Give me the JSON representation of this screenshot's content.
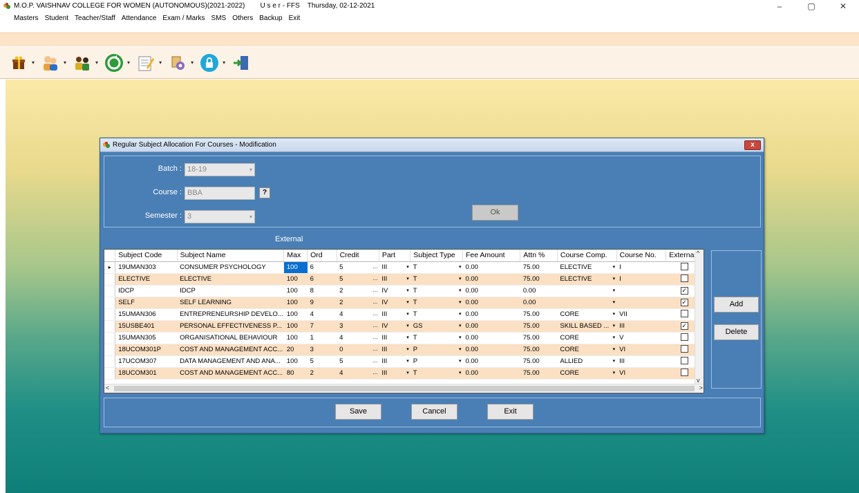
{
  "window": {
    "title": "M.O.P. VAISHNAV COLLEGE FOR WOMEN (AUTONOMOUS)(2021-2022)        U s e r - FFS    Thursday, 02-12-2021",
    "controls": [
      "–",
      "▢",
      "✕"
    ]
  },
  "menu": [
    "Masters",
    "Student",
    "Teacher/Staff",
    "Attendance",
    "Exam / Marks",
    "SMS",
    "Others",
    "Backup",
    "Exit"
  ],
  "toolbar_icons": [
    "gift-icon",
    "users-icon",
    "people-icon",
    "sync-icon",
    "notepad-icon",
    "settings-icon",
    "lock-icon",
    "exit-door-icon"
  ],
  "dialog": {
    "title": "Regular Subject Allocation For Courses - Modification",
    "close": "x",
    "batch_label": "Batch :",
    "batch_value": "18-19",
    "course_label": "Course :",
    "course_value": "BBA",
    "course_help": "?",
    "semester_label": "Semester :",
    "semester_value": "3",
    "ok_label": "Ok",
    "external_label": "External",
    "add_label": "Add",
    "delete_label": "Delete",
    "save_label": "Save",
    "cancel_label": "Cancel",
    "exit_label": "Exit"
  },
  "grid": {
    "columns": [
      "Subject Code",
      "Subject Name",
      "Max",
      "Ord",
      "Credit",
      "Part",
      "Subject Type",
      "Fee Amount",
      "Attn %",
      "Course Comp.",
      "Course No.",
      "Externa"
    ],
    "rows": [
      {
        "code": "19UMAN303",
        "name": "CONSUMER PSYCHOLOGY",
        "max": "100",
        "ord": "6",
        "credit": "5",
        "part": "III",
        "type": "T",
        "fee": "0.00",
        "attn": "75.00",
        "comp": "ELECTIVE",
        "no": "I",
        "ext": false
      },
      {
        "code": "ELECTIVE",
        "name": "ELECTIVE",
        "max": "100",
        "ord": "6",
        "credit": "5",
        "part": "III",
        "type": "T",
        "fee": "0.00",
        "attn": "75.00",
        "comp": "ELECTIVE",
        "no": "I",
        "ext": false
      },
      {
        "code": "IDCP",
        "name": "IDCP",
        "max": "100",
        "ord": "8",
        "credit": "2",
        "part": "IV",
        "type": "T",
        "fee": "0.00",
        "attn": "0.00",
        "comp": "",
        "no": "",
        "ext": true
      },
      {
        "code": "SELF",
        "name": "SELF LEARNING",
        "max": "100",
        "ord": "9",
        "credit": "2",
        "part": "IV",
        "type": "T",
        "fee": "0.00",
        "attn": "0.00",
        "comp": "",
        "no": "",
        "ext": true
      },
      {
        "code": "15UMAN306",
        "name": "ENTREPRENEURSHIP DEVELO...",
        "max": "100",
        "ord": "4",
        "credit": "4",
        "part": "III",
        "type": "T",
        "fee": "0.00",
        "attn": "75.00",
        "comp": "CORE",
        "no": "VII",
        "ext": false
      },
      {
        "code": "15USBE401",
        "name": "PERSONAL EFFECTIVENESS P...",
        "max": "100",
        "ord": "7",
        "credit": "3",
        "part": "IV",
        "type": "GS",
        "fee": "0.00",
        "attn": "75.00",
        "comp": "SKILL BASED ...",
        "no": "III",
        "ext": true
      },
      {
        "code": "15UMAN305",
        "name": "ORGANISATIONAL BEHAVIOUR",
        "max": "100",
        "ord": "1",
        "credit": "4",
        "part": "III",
        "type": "T",
        "fee": "0.00",
        "attn": "75.00",
        "comp": "CORE",
        "no": "V",
        "ext": false
      },
      {
        "code": "18UCOM301P",
        "name": "COST AND MANAGEMENT ACC...",
        "max": "20",
        "ord": "3",
        "credit": "0",
        "part": "III",
        "type": "P",
        "fee": "0.00",
        "attn": "75.00",
        "comp": "CORE",
        "no": "VI",
        "ext": false
      },
      {
        "code": "17UCOM307",
        "name": "DATA MANAGEMENT AND ANA...",
        "max": "100",
        "ord": "5",
        "credit": "5",
        "part": "III",
        "type": "P",
        "fee": "0.00",
        "attn": "75.00",
        "comp": "ALLIED",
        "no": "III",
        "ext": false
      },
      {
        "code": "18UCOM301",
        "name": "COST AND MANAGEMENT ACC...",
        "max": "80",
        "ord": "2",
        "credit": "4",
        "part": "III",
        "type": "T",
        "fee": "0.00",
        "attn": "75.00",
        "comp": "CORE",
        "no": "VI",
        "ext": false
      }
    ]
  }
}
